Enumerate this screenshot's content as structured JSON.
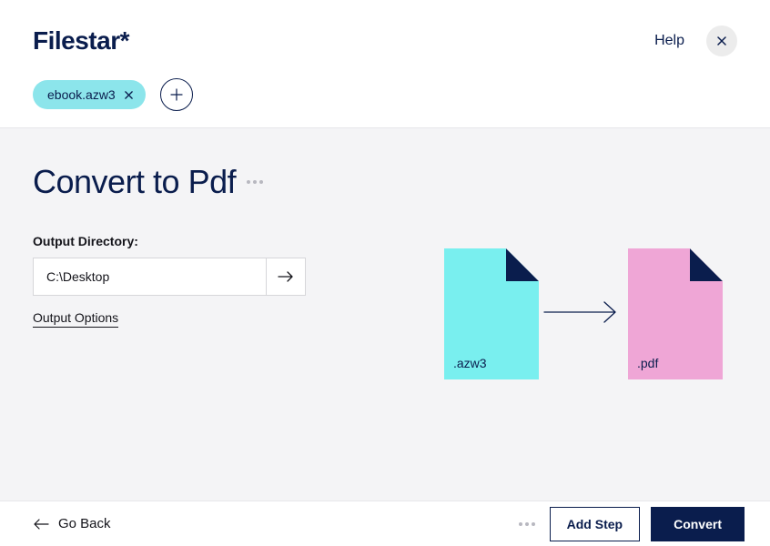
{
  "header": {
    "logo": "Filestar*",
    "help_label": "Help"
  },
  "file_chip": {
    "name": "ebook.azw3"
  },
  "main": {
    "title": "Convert to Pdf",
    "output_dir_label": "Output Directory:",
    "output_dir_value": "C:\\Desktop",
    "output_options_label": "Output Options"
  },
  "illus": {
    "from_ext": ".azw3",
    "to_ext": ".pdf"
  },
  "footer": {
    "go_back_label": "Go Back",
    "add_step_label": "Add Step",
    "convert_label": "Convert"
  }
}
